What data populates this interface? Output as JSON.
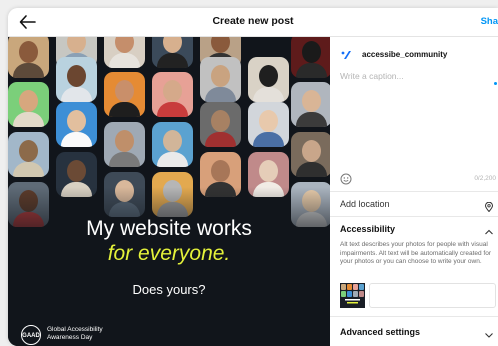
{
  "header": {
    "title": "Create new post",
    "share_label": "Sha"
  },
  "post_image": {
    "headline_line1": "My website works",
    "headline_line2": "for everyone.",
    "headline_line3": "Does yours?",
    "logo_text": "GAAD",
    "org_line1": "Global Accessibility",
    "org_line2": "Awareness Day",
    "accent_color": "#e4f23a",
    "background_color": "#11151b"
  },
  "sidebar": {
    "username": "accessibe_community",
    "caption_placeholder": "Write a caption...",
    "char_count": "0/2,200",
    "add_location_label": "Add location",
    "accessibility_label": "Accessibility",
    "alt_text_description": "Alt text describes your photos for people with visual impairments. Alt text will be automatically created for your photos or you can choose to write your own.",
    "advanced_settings_label": "Advanced settings",
    "accent_color": "#0095f6"
  }
}
